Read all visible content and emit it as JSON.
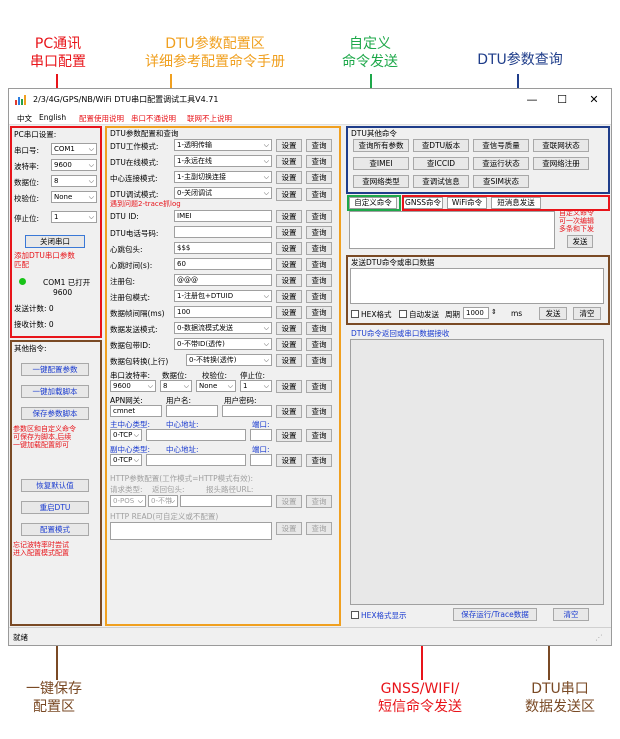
{
  "annotations": {
    "pc_serial": [
      "PC通讯",
      "串口配置"
    ],
    "dtu_params": [
      "DTU参数配置区",
      "详细参考配置命令手册"
    ],
    "custom_cmd": [
      "自定义",
      "命令发送"
    ],
    "dtu_query": "DTU参数查询",
    "save_config": [
      "一键保存",
      "配置区"
    ],
    "gnss_cmd": [
      "GNSS/WIFI/",
      "短信命令发送"
    ],
    "dtu_serial_send": [
      "DTU串口",
      "数据发送区"
    ]
  },
  "colors": {
    "red": "#e8141a",
    "orange": "#f0a020",
    "green": "#1ea84a",
    "blue": "#1f3d8a",
    "brown": "#7a4a25"
  },
  "window": {
    "title": "2/3/4G/GPS/NB/WiFi DTU串口配置调试工具V4.71",
    "icon": "bar-chart-icon",
    "controls": [
      "—",
      "☐",
      "✕"
    ]
  },
  "menu": {
    "lang_cn": "中文",
    "lang_en": "English",
    "guide": "配置使用说明",
    "serial_fail": "串口不通说明",
    "net_fail": "联网不上说明"
  },
  "pc_serial": {
    "title": "PC串口设置:",
    "port_label": "串口号:",
    "port_value": "COM1",
    "baud_label": "波特率:",
    "baud_value": "9600",
    "data_label": "数据位:",
    "data_value": "8",
    "parity_label": "校验位:",
    "parity_value": "None",
    "stop_label": "停止位:",
    "stop_value": "1",
    "close_button": "关闭串口",
    "note": [
      "添加DTU串口参数",
      "匹配"
    ],
    "status_port": "COM1 已打开",
    "status_baud": "9600",
    "sent_count": "发送计数: 0",
    "recv_count": "接收计数: 0"
  },
  "other_cmds": {
    "title": "其他指令:",
    "one_key_config": "一键配置参数",
    "one_key_script": "一键加载脚本",
    "save_script": "保存参数脚本",
    "note": [
      "参数区和自定义命令",
      "可保存为脚本,后续",
      "一键加载配置即可"
    ],
    "restore": "恢复默认值",
    "restart": "重启DTU",
    "config_mode": "配置模式",
    "note2": [
      "忘记波特率时尝试",
      "进入配置模式配置"
    ]
  },
  "params": {
    "title": "DTU参数配置和查询",
    "set": "设置",
    "query": "查询",
    "work_mode_label": "DTU工作模式:",
    "work_mode_value": "1-透明传输",
    "online_mode_label": "DTU在线模式:",
    "online_mode_value": "1-永远在线",
    "center_mode_label": "中心连接模式:",
    "center_mode_value": "1-主副切换连接",
    "debug_mode_label": "DTU调试模式:",
    "debug_mode_value": "0-关闭调试",
    "debug_note": "遇到问题2-trace抓log",
    "id_label": "DTU ID:",
    "id_value": "IMEI",
    "phone_label": "DTU电话号码:",
    "phone_value": "",
    "hb_label": "心跳包头:",
    "hb_value": "$$$",
    "hb_time_label": "心跳时间(s):",
    "hb_time_value": "60",
    "reg_label": "注册包:",
    "reg_value": "@@@",
    "reg_mode_label": "注册包模式:",
    "reg_mode_value": "1-注册包+DTUID",
    "frame_label": "数据帧间隔(ms)",
    "frame_value": "100",
    "send_mode_label": "数据发送模式:",
    "send_mode_value": "0-数据流模式发送",
    "pkt_id_label": "数据包带ID:",
    "pkt_id_value": "0-不带ID(透传)",
    "convert_label": "数据包转换(上行)",
    "convert_value": "0-不转换(透传)",
    "serial_baud_label": "串口波特率:",
    "serial_data_label": "数据位:",
    "serial_parity_label": "校验位:",
    "serial_stop_label": "停止位:",
    "serial_baud_value": "9600",
    "serial_data_value": "8",
    "serial_parity_value": "None",
    "serial_stop_value": "1",
    "apn_label": "APN网关:",
    "user_label": "用户名:",
    "pwd_label": "用户密码:",
    "apn_value": "cmnet",
    "main_center_label": "主中心类型:",
    "main_addr_label": "中心地址:",
    "main_port_label": "端口:",
    "main_type_value": "0-TCP",
    "sub_center_label": "副中心类型:",
    "sub_addr_label": "中心地址:",
    "sub_port_label": "端口:",
    "sub_type_value": "0-TCP",
    "http_title": "HTTP参数配置(工作模式=HTTP模式有效):",
    "http_req_label": "请求类型:",
    "http_head_label": "返回包头:",
    "http_url_label": "报头路径URL:",
    "http_method_value": "0-POS",
    "http_head_value": "0-不带",
    "http_read_title": "HTTP READ(可自定义或不配置)"
  },
  "dtu_query": {
    "title": "DTU其他命令",
    "buttons": [
      "查询所有参数",
      "查DTU版本",
      "查信号质量",
      "查联网状态",
      "查IMEI",
      "查ICCID",
      "查运行状态",
      "查网络注册",
      "查网络类型",
      "查调试信息",
      "查SIM状态"
    ]
  },
  "custom_cmd": {
    "tab_custom": "自定义命令",
    "tab_gnss": "GNSS命令",
    "tab_wifi": "WiFi命令",
    "tab_sms": "短消息发送",
    "note": [
      "自定义命令",
      "可一次编辑",
      "多条和下发"
    ],
    "send": "发送"
  },
  "serial_send": {
    "title": "发送DTU命令或串口数据",
    "hex_label": "HEX格式",
    "auto_label": "自动发送",
    "period_label": "周期",
    "period_value": "1000",
    "ms_label": "ms",
    "send": "发送",
    "clear": "清空"
  },
  "recv": {
    "title": "DTU命令返回或串口数据接收",
    "hex_show": "HEX格式显示",
    "save_trace": "保存运行/Trace数据",
    "clear": "清空"
  },
  "status": {
    "text": "就绪"
  }
}
